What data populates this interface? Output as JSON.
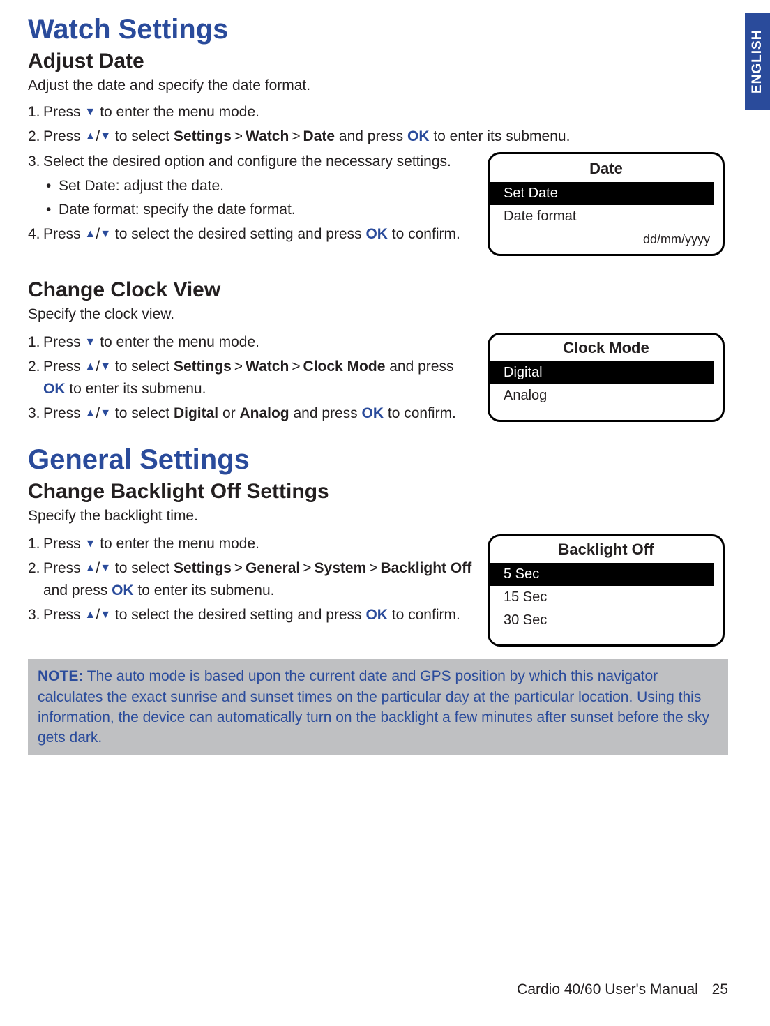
{
  "lang_tab": "ENGLISH",
  "h1_watch": "Watch Settings",
  "adjust_date": {
    "heading": "Adjust Date",
    "intro": "Adjust the date and specify the date format.",
    "steps": {
      "s1_num": "1.",
      "s1_a": "Press ",
      "s1_b": " to enter the menu mode.",
      "s2_num": "2.",
      "s2_a": "Press ",
      "s2_b": " to select ",
      "s2_settings": "Settings",
      "s2_watch": "Watch",
      "s2_date": "Date",
      "s2_c": " and press ",
      "s2_ok": "OK",
      "s2_d": " to enter its submenu.",
      "s3_num": "3.",
      "s3_a": "Select the desired option and configure the necessary settings.",
      "s3_sub1": "Set Date: adjust the date.",
      "s3_sub2": "Date format: specify the date format.",
      "s4_num": "4.",
      "s4_a": "Press ",
      "s4_b": " to select the desired setting and press ",
      "s4_ok": "OK",
      "s4_c": " to confirm."
    },
    "device": {
      "title": "Date",
      "item1": "Set Date",
      "item2": "Date format",
      "foot": "dd/mm/yyyy"
    }
  },
  "clock": {
    "heading": "Change Clock View",
    "intro": "Specify the clock view.",
    "steps": {
      "s1_num": "1.",
      "s1_a": "Press ",
      "s1_b": " to enter the menu mode.",
      "s2_num": "2.",
      "s2_a": "Press ",
      "s2_b": " to select ",
      "s2_settings": "Settings",
      "s2_watch": "Watch",
      "s2_mode": "Clock Mode",
      "s2_c": " and press ",
      "s2_ok": "OK",
      "s2_d": " to enter its submenu.",
      "s3_num": "3.",
      "s3_a": "Press ",
      "s3_b": " to select ",
      "s3_dig": "Digital",
      "s3_or": " or ",
      "s3_ana": "Analog",
      "s3_c": " and press ",
      "s3_ok": "OK",
      "s3_d": " to confirm."
    },
    "device": {
      "title": "Clock Mode",
      "item1": "Digital",
      "item2": "Analog"
    }
  },
  "h1_general": "General Settings",
  "backlight": {
    "heading": "Change Backlight Off Settings",
    "intro": "Specify the backlight time.",
    "steps": {
      "s1_num": "1.",
      "s1_a": "Press ",
      "s1_b": " to enter the menu mode.",
      "s2_num": "2.",
      "s2_a": "Press ",
      "s2_b": " to select ",
      "s2_settings": "Settings",
      "s2_general": "General",
      "s2_system": "System",
      "s2_bl": "Backlight Off",
      "s2_c": " and press ",
      "s2_ok": "OK",
      "s2_d": " to enter its submenu.",
      "s3_num": "3.",
      "s3_a": "Press ",
      "s3_b": " to select the desired setting and press ",
      "s3_ok": "OK",
      "s3_c": " to confirm."
    },
    "device": {
      "title": "Backlight Off",
      "item1": "5 Sec",
      "item2": "15 Sec",
      "item3": "30 Sec"
    }
  },
  "note": {
    "label": "NOTE:",
    "text": " The auto mode is based upon the current date and GPS position by which this navigator calculates the exact sunrise and sunset times on the particular day at the particular location. Using this information, the device can automatically turn on the backlight a few minutes after sunset before the sky gets dark."
  },
  "footer": {
    "title": "Cardio 40/60 User's Manual",
    "page": "25"
  },
  "gt": ">"
}
